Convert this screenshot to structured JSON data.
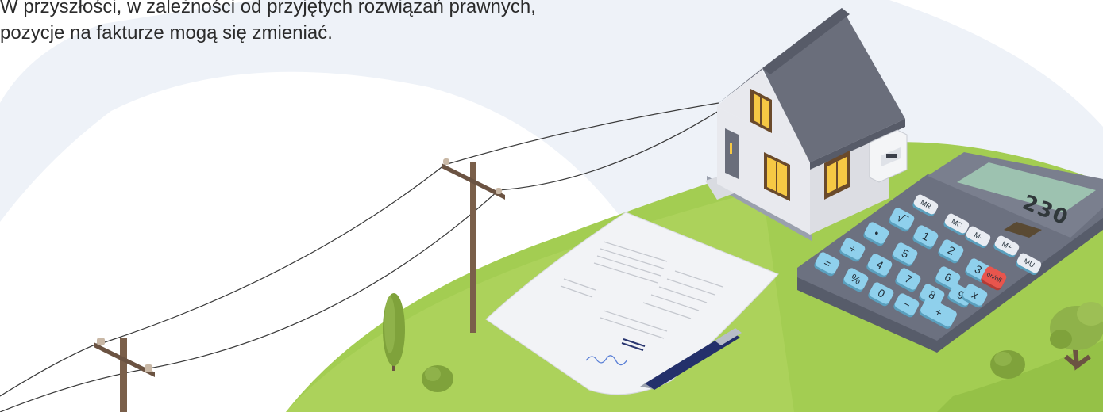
{
  "caption": {
    "line1": "W przyszłości, w zależności od przyjętych rozwiązań prawnych,",
    "line2": "pozycje na fakturze mogą się zmieniać."
  },
  "calculator": {
    "display": "230",
    "keys_top": [
      "MR",
      "MC",
      "M-",
      "M+",
      "MU"
    ],
    "keys_grid": [
      "=",
      "÷",
      "•",
      "√‾",
      "1",
      "2",
      "3",
      "%",
      "4",
      "5",
      "6",
      "on/off",
      "0",
      "7",
      "8",
      "9",
      "x",
      "−",
      "+"
    ]
  },
  "colors": {
    "sky_blob": "#eef2f8",
    "grass": "#a3cd52",
    "roof": "#6a6e7b",
    "house_wall": "#e8e9ee",
    "window_light": "#f6c844",
    "calc_body": "#6c7180",
    "calc_key": "#8fd0ec",
    "calc_onoff": "#e8554d"
  }
}
